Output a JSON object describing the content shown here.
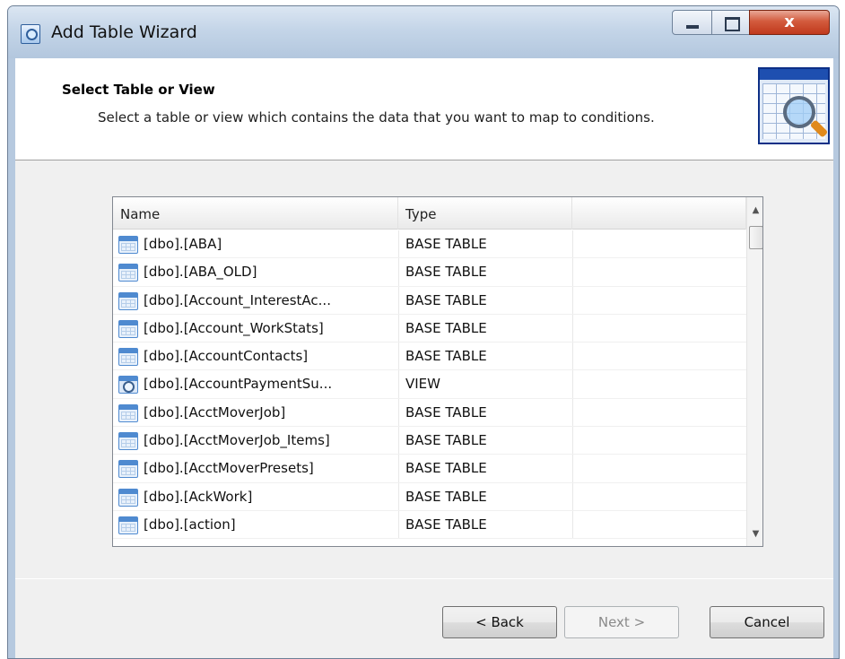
{
  "window": {
    "title": "Add Table Wizard",
    "close_glyph": "x"
  },
  "header": {
    "title": "Select Table or View",
    "description": "Select a table or view which contains the data that you want to map to conditions."
  },
  "listview": {
    "columns": [
      "Name",
      "Type",
      ""
    ],
    "rows": [
      {
        "name": "[dbo].[ABA]",
        "type": "BASE TABLE",
        "icon": "table-icon"
      },
      {
        "name": "[dbo].[ABA_OLD]",
        "type": "BASE TABLE",
        "icon": "table-icon"
      },
      {
        "name": "[dbo].[Account_InterestAc...",
        "type": "BASE TABLE",
        "icon": "table-icon"
      },
      {
        "name": "[dbo].[Account_WorkStats]",
        "type": "BASE TABLE",
        "icon": "table-icon"
      },
      {
        "name": "[dbo].[AccountContacts]",
        "type": "BASE TABLE",
        "icon": "table-icon"
      },
      {
        "name": "[dbo].[AccountPaymentSu...",
        "type": "VIEW",
        "icon": "view-icon"
      },
      {
        "name": "[dbo].[AcctMoverJob]",
        "type": "BASE TABLE",
        "icon": "table-icon"
      },
      {
        "name": "[dbo].[AcctMoverJob_Items]",
        "type": "BASE TABLE",
        "icon": "table-icon"
      },
      {
        "name": "[dbo].[AcctMoverPresets]",
        "type": "BASE TABLE",
        "icon": "table-icon"
      },
      {
        "name": "[dbo].[AckWork]",
        "type": "BASE TABLE",
        "icon": "table-icon"
      },
      {
        "name": "[dbo].[action]",
        "type": "BASE TABLE",
        "icon": "table-icon"
      }
    ]
  },
  "buttons": {
    "back": "< Back",
    "next": "Next >",
    "cancel": "Cancel"
  },
  "colors": {
    "accent": "#4f8ad0",
    "close": "#c0391c"
  }
}
